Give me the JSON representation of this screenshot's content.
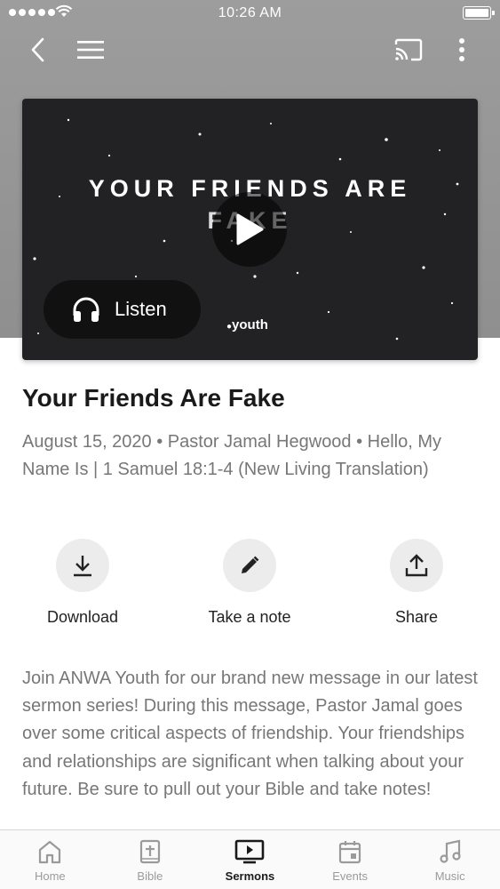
{
  "status_bar": {
    "time": "10:26 AM"
  },
  "video": {
    "title_line1": "YOUR FRIENDS ARE",
    "title_line2": "FAKE",
    "listen_label": "Listen",
    "logo_text": "youth"
  },
  "sermon": {
    "title": "Your Friends Are Fake",
    "meta": "August 15, 2020 • Pastor Jamal Hegwood • Hello, My Name Is | 1 Samuel 18:1-4 (New Living Translation)",
    "description": "Join ANWA Youth for our brand new message in our latest sermon series! During this message, Pastor Jamal goes over some critical aspects of friendship. Your friendships and relationships are significant when talking about your future. Be sure to pull out your Bible and take notes!"
  },
  "actions": {
    "download": "Download",
    "note": "Take a note",
    "share": "Share"
  },
  "tabs": {
    "home": "Home",
    "bible": "Bible",
    "sermons": "Sermons",
    "events": "Events",
    "music": "Music"
  },
  "colors": {
    "accent": "#1a1a1a",
    "muted": "#777777",
    "header": "#999999"
  },
  "icons": [
    "back-icon",
    "menu-icon",
    "cast-icon",
    "more-icon",
    "play-icon",
    "headphones-icon",
    "download-icon",
    "pencil-icon",
    "share-icon",
    "home-icon",
    "bible-icon",
    "sermons-icon",
    "events-icon",
    "music-icon"
  ]
}
